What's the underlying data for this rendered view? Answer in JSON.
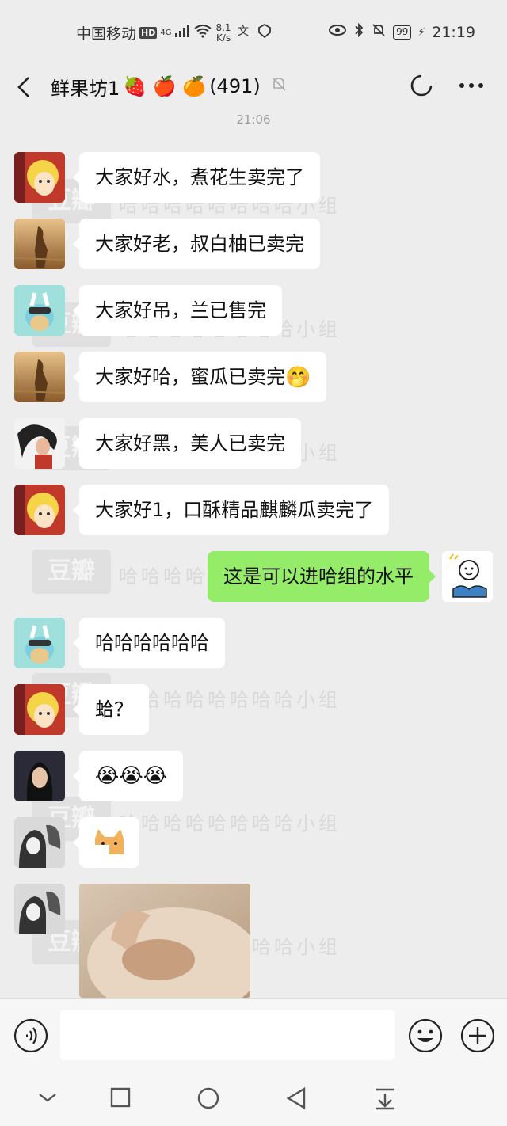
{
  "status_bar": {
    "carrier": "中国移动",
    "hd": "HD",
    "network": "4G",
    "speed_value": "8.1",
    "speed_unit": "K/s",
    "battery": "99",
    "time": "21:19"
  },
  "header": {
    "title": "鲜果坊1",
    "title_emojis": "🍓 🍎 🍊",
    "member_count": "(491)"
  },
  "chat": {
    "time_label": "21:06",
    "messages": [
      {
        "text": "大家好水，煮花生卖完了"
      },
      {
        "text": "大家好老，叔白柚已卖完"
      },
      {
        "text": "大家好吊，兰已售完"
      },
      {
        "text": "大家好哈，蜜瓜已卖完",
        "emoji": "🤭"
      },
      {
        "text": "大家好黑，美人已卖完"
      },
      {
        "text": "大家好1，口酥精品麒麟瓜卖完了"
      },
      {
        "text": "这是可以进哈组的水平"
      },
      {
        "text": "哈哈哈哈哈哈"
      },
      {
        "text": "蛤？"
      },
      {
        "text": "😭😭😭"
      }
    ]
  },
  "watermark": {
    "text": "哈哈哈哈哈哈哈哈小组",
    "logo": "豆瓣"
  },
  "colors": {
    "background": "#ededed",
    "my_bubble": "#95ec69",
    "other_bubble": "#ffffff"
  }
}
